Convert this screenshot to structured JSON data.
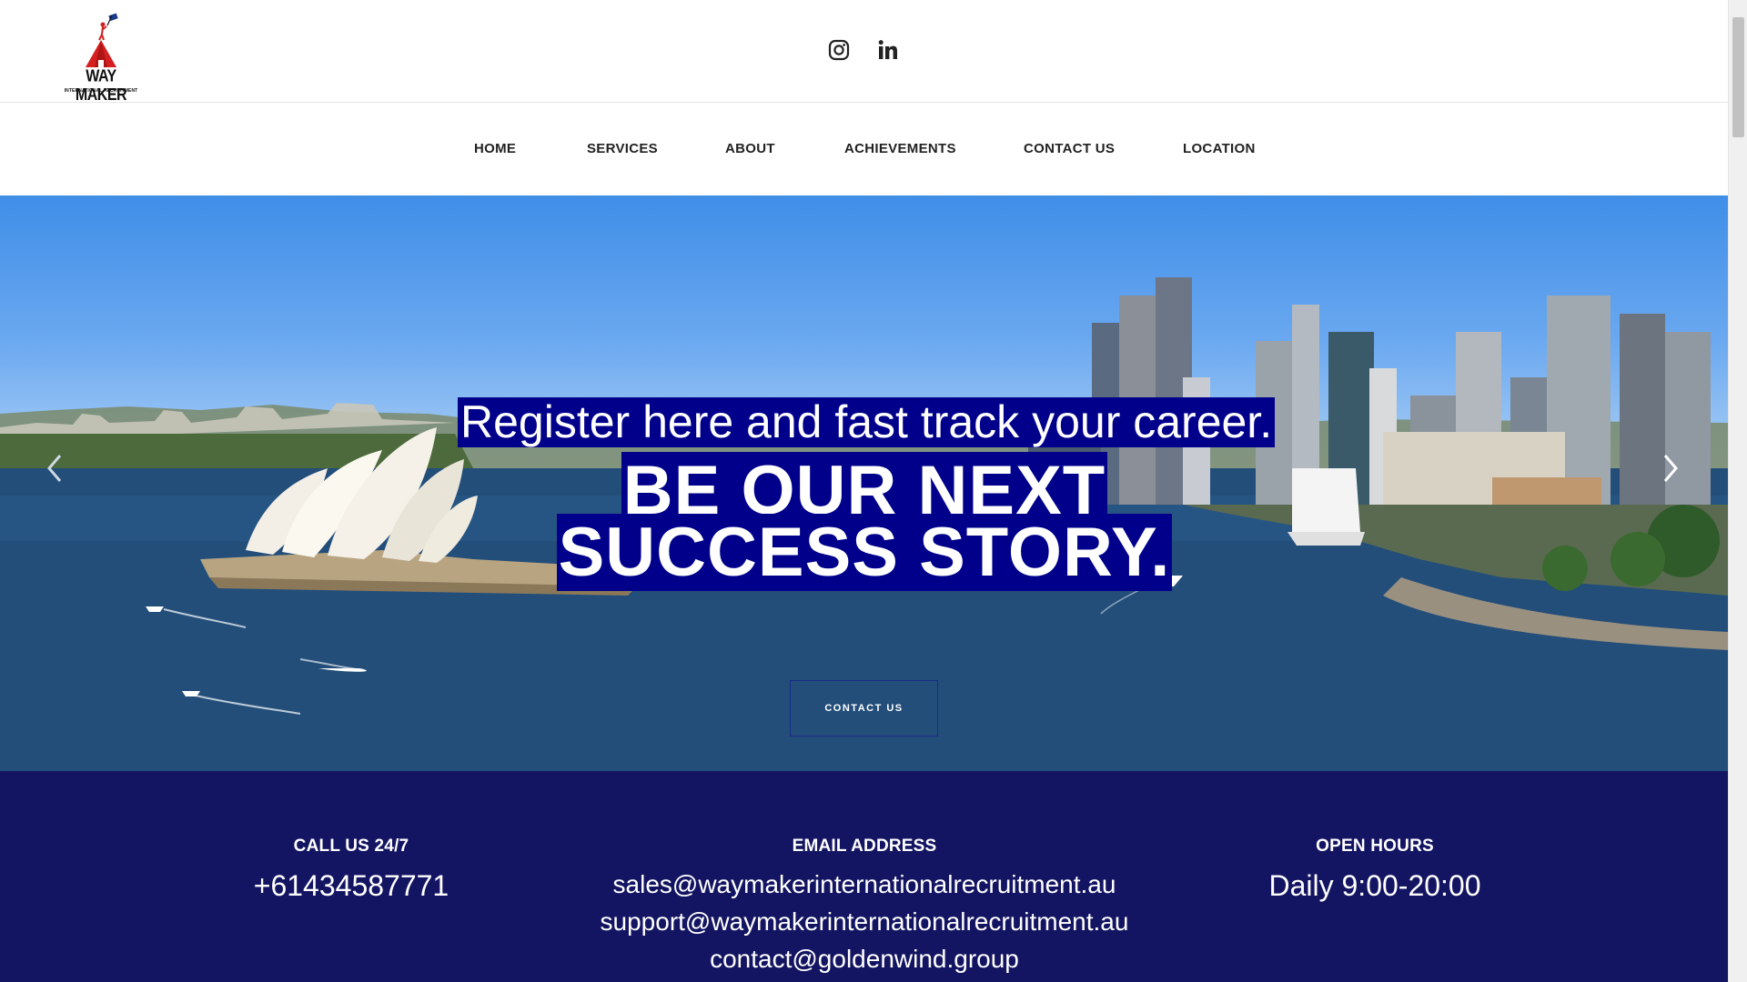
{
  "brand": {
    "name": "WAY MAKER",
    "tagline": "INTERNATIONAL RECRUITMENT",
    "logo_red": "#d42020",
    "logo_blue": "#1a3a8a"
  },
  "social": {
    "instagram": "instagram-icon",
    "linkedin": "linkedin-icon"
  },
  "nav": {
    "items": [
      {
        "label": "HOME"
      },
      {
        "label": "SERVICES"
      },
      {
        "label": "ABOUT"
      },
      {
        "label": "ACHIEVEMENTS"
      },
      {
        "label": "CONTACT US"
      },
      {
        "label": "LOCATION"
      }
    ]
  },
  "hero": {
    "line1": "Register here and fast track your career.",
    "title": "BE OUR NEXT SUCCESS STORY.",
    "button": "CONTACT US",
    "highlight_color": "#00008b",
    "prev_icon": "chevron-left-icon",
    "next_icon": "chevron-right-icon"
  },
  "info": {
    "background": "#141562",
    "call": {
      "heading": "CALL US 24/7",
      "value": "+61434587771"
    },
    "email": {
      "heading": "EMAIL ADDRESS",
      "values": [
        "sales@waymakerinternationalrecruitment.au",
        "support@waymakerinternationalrecruitment.au",
        "contact@goldenwind.group"
      ]
    },
    "hours": {
      "heading": "OPEN HOURS",
      "value": "Daily 9:00-20:00"
    }
  }
}
